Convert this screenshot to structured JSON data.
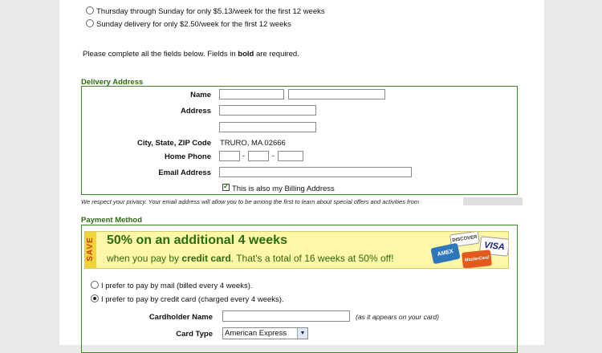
{
  "delivery_options": [
    {
      "label": "Thursday through Sunday for only $5.13/week for the first 12 weeks",
      "selected": false
    },
    {
      "label": "Sunday delivery for only $2.50/week for the first 12 weeks",
      "selected": false
    }
  ],
  "instructions": {
    "prefix": "Please complete all the fields below. Fields in ",
    "bold": "bold",
    "suffix": " are required."
  },
  "delivery_address": {
    "title": "Delivery Address",
    "name_label": "Name",
    "address_label": "Address",
    "city_state_zip_label": "City, State, ZIP Code",
    "city_state_zip_value": "TRURO, MA 02666",
    "home_phone_label": "Home Phone",
    "email_label": "Email Address",
    "billing_checkbox_label": "This is also my Billing Address",
    "billing_checked": true,
    "phone_separator": "-"
  },
  "privacy_note": "We respect your privacy. Your email address will allow you to be among the first to learn about special offers and activities from",
  "payment": {
    "title": "Payment Method",
    "banner": {
      "save": "SAVE",
      "headline": "50% on an additional 4 weeks",
      "line_pre": "when you pay by ",
      "line_bold": "credit card",
      "line_post": ". That's a total of 16 weeks at 50% off!",
      "cards": [
        "DISCOVER",
        "VISA",
        "AMEX",
        "MasterCard"
      ]
    },
    "options": [
      {
        "label": "I prefer to pay by mail (billed every 4 weeks).",
        "selected": false
      },
      {
        "label": "I prefer to pay by credit card (charged every 4 weeks).",
        "selected": true
      }
    ],
    "cardholder_label": "Cardholder Name",
    "cardholder_hint": "(as it appears on your card)",
    "card_type_label": "Card Type",
    "card_type_value": "American Express"
  },
  "colors": {
    "section_green": "#2b6b12",
    "banner_yellow": "#fff7a8",
    "save_red": "#d23b12"
  }
}
